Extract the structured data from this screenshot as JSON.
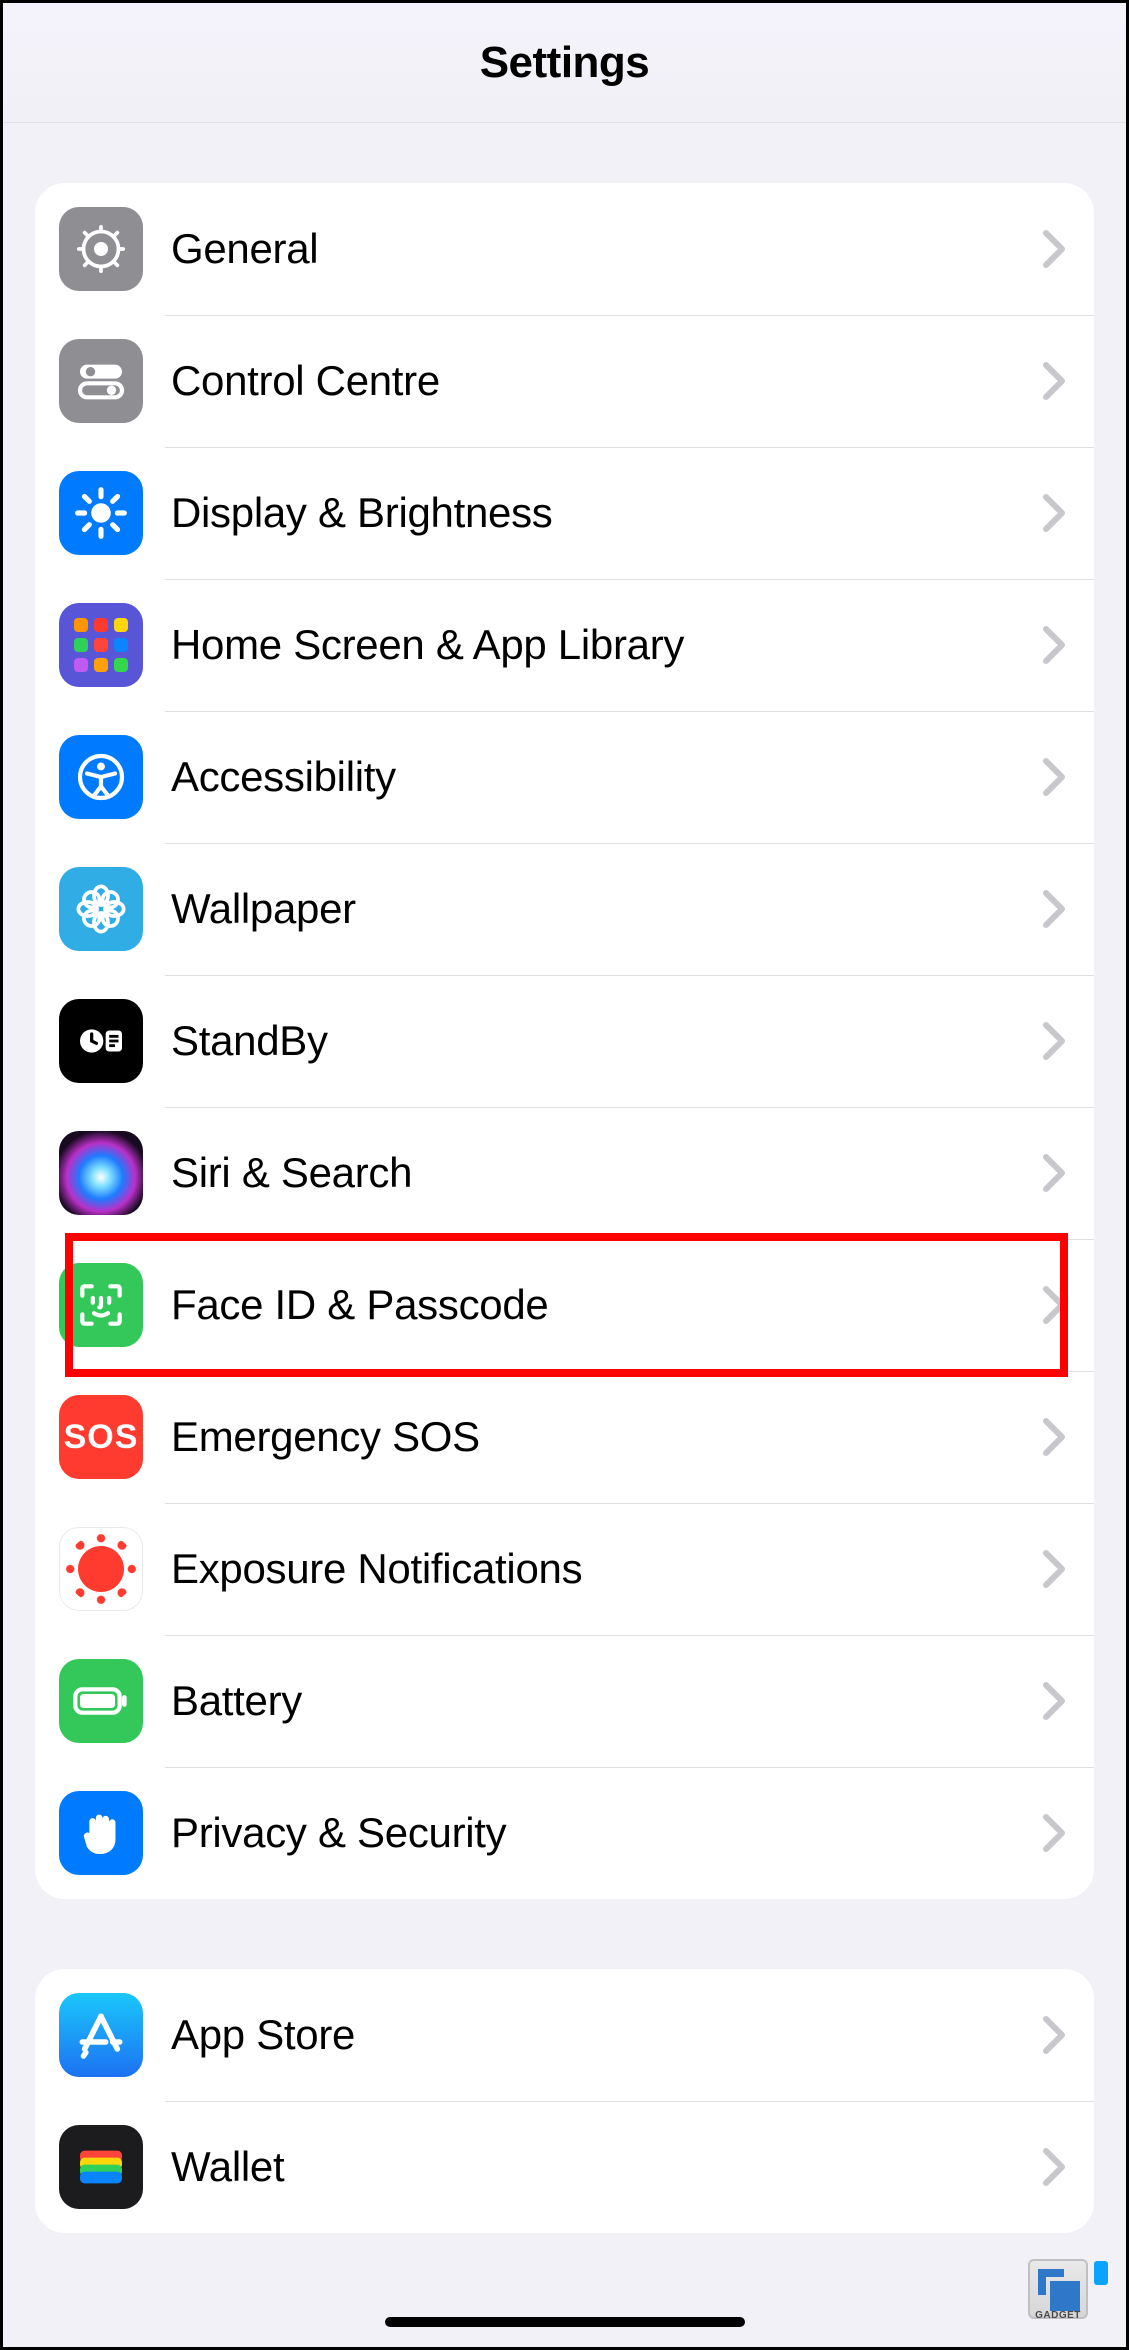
{
  "header": {
    "title": "Settings"
  },
  "groups": [
    {
      "items": [
        {
          "id": "general",
          "label": "General",
          "icon": "gear-icon",
          "bg": "bg-gray"
        },
        {
          "id": "control-centre",
          "label": "Control Centre",
          "icon": "toggles-icon",
          "bg": "bg-gray"
        },
        {
          "id": "display",
          "label": "Display & Brightness",
          "icon": "sun-icon",
          "bg": "bg-blue"
        },
        {
          "id": "home-screen",
          "label": "Home Screen & App Library",
          "icon": "app-grid-icon",
          "bg": "bg-purple"
        },
        {
          "id": "accessibility",
          "label": "Accessibility",
          "icon": "accessibility-icon",
          "bg": "bg-blue"
        },
        {
          "id": "wallpaper",
          "label": "Wallpaper",
          "icon": "flower-icon",
          "bg": "bg-cyan"
        },
        {
          "id": "standby",
          "label": "StandBy",
          "icon": "clock-card-icon",
          "bg": "bg-black"
        },
        {
          "id": "siri",
          "label": "Siri & Search",
          "icon": "siri-icon",
          "bg": "bg-siri"
        },
        {
          "id": "faceid",
          "label": "Face ID & Passcode",
          "icon": "faceid-icon",
          "bg": "bg-green",
          "highlighted": true
        },
        {
          "id": "sos",
          "label": "Emergency SOS",
          "icon": "sos-icon",
          "bg": "bg-red"
        },
        {
          "id": "exposure",
          "label": "Exposure Notifications",
          "icon": "exposure-icon",
          "bg": "bg-white"
        },
        {
          "id": "battery",
          "label": "Battery",
          "icon": "battery-icon",
          "bg": "bg-green"
        },
        {
          "id": "privacy",
          "label": "Privacy & Security",
          "icon": "hand-icon",
          "bg": "bg-blue"
        }
      ]
    },
    {
      "items": [
        {
          "id": "appstore",
          "label": "App Store",
          "icon": "appstore-icon",
          "bg": "bg-blue-appstore"
        },
        {
          "id": "wallet",
          "label": "Wallet",
          "icon": "wallet-icon",
          "bg": "bg-wallet"
        }
      ]
    }
  ],
  "watermark": {
    "text": "GADGET"
  }
}
